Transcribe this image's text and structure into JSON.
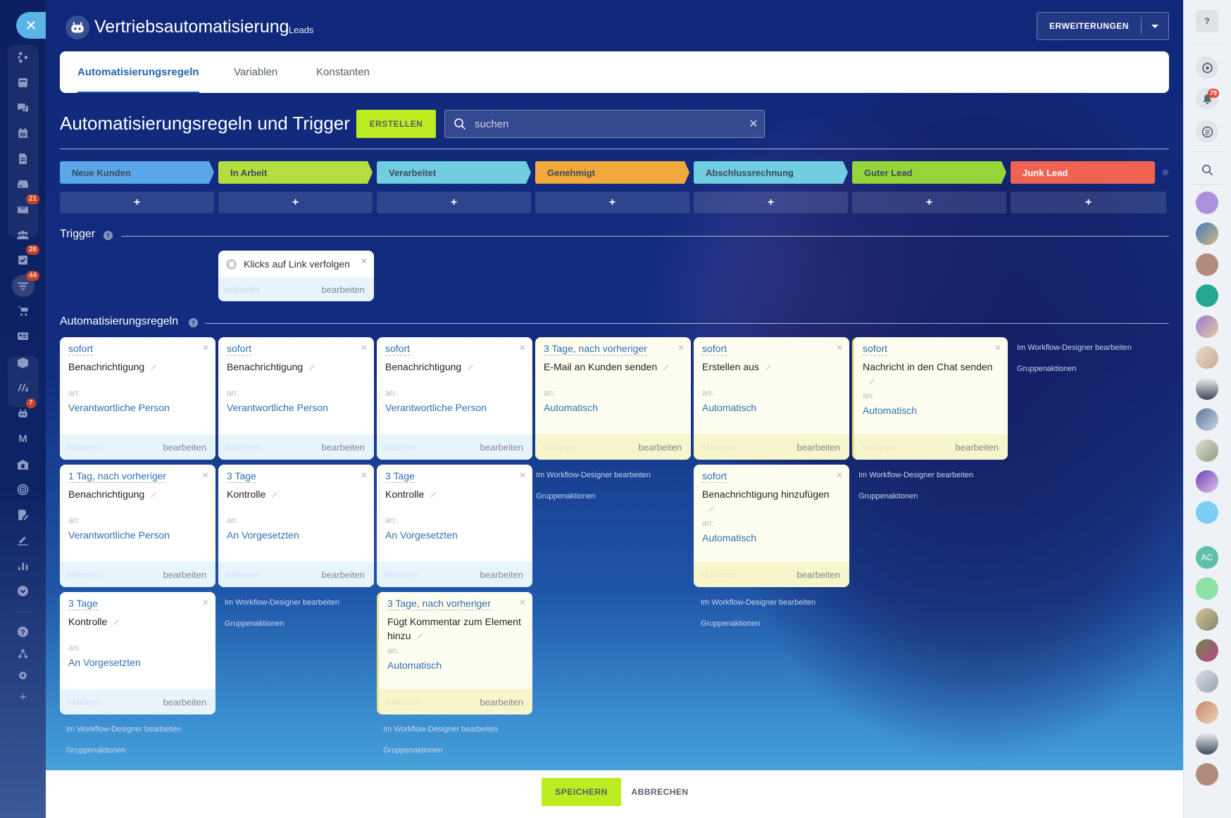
{
  "app": {
    "title": "Vertriebsautomatisierung",
    "subtitle": "Leads",
    "extensions_label": "ERWEITERUNGEN"
  },
  "tabs": [
    {
      "label": "Automatisierungsregeln",
      "active": true
    },
    {
      "label": "Variablen",
      "active": false
    },
    {
      "label": "Konstanten",
      "active": false
    }
  ],
  "toolbar": {
    "page_title": "Automatisierungsregeln und Trigger",
    "create_label": "ERSTELLEN",
    "search_placeholder": "suchen",
    "search_value": ""
  },
  "stages": [
    {
      "label": "Neue Kunden",
      "color": "#5aa6e8"
    },
    {
      "label": "In Arbeit",
      "color": "#b6dd3f"
    },
    {
      "label": "Verarbeitet",
      "color": "#71cde0"
    },
    {
      "label": "Genehmigt",
      "color": "#f2a93b"
    },
    {
      "label": "Abschlussrechnung",
      "color": "#71cde0"
    },
    {
      "label": "Guter Lead",
      "color": "#96d43c"
    },
    {
      "label": "Junk Lead",
      "color": "#ee6352"
    }
  ],
  "add_label": "+",
  "sections": {
    "trigger": "Trigger",
    "rules": "Automatisierungsregeln"
  },
  "trigger_card": {
    "name": "Klicks auf Link verfolgen",
    "copy": "kopieren",
    "edit": "bearbeiten"
  },
  "card_labels": {
    "to": "an:",
    "actions": "Aktionen",
    "edit": "bearbeiten"
  },
  "links": {
    "workflow": "Im Workflow-Designer bearbeiten",
    "group": "Gruppenaktionen"
  },
  "rules": [
    {
      "delay": "sofort",
      "name": "Benachrichtigung",
      "to": "Verantwortliche Person"
    },
    {
      "delay": "sofort",
      "name": "Benachrichtigung",
      "to": "Verantwortliche Person"
    },
    {
      "delay": "sofort",
      "name": "Benachrichtigung",
      "to": "Verantwortliche Person"
    },
    {
      "delay": "3 Tage, nach vorheriger",
      "name": "E-Mail an Kunden senden",
      "to": "Automatisch"
    },
    {
      "delay": "sofort",
      "name": "Erstellen aus",
      "to": "Automatisch"
    },
    {
      "delay": "sofort",
      "name": "Nachricht in den Chat senden",
      "to": "Automatisch"
    },
    {
      "delay": "1 Tag, nach vorheriger",
      "name": "Benachrichtigung",
      "to": "Verantwortliche Person"
    },
    {
      "delay": "3 Tage",
      "name": "Kontrolle",
      "to": "An Vorgesetzten"
    },
    {
      "delay": "3 Tage",
      "name": "Kontrolle",
      "to": "An Vorgesetzten"
    },
    {
      "delay": "sofort",
      "name": "Benachrichtigung hinzufügen",
      "to": "Automatisch"
    },
    {
      "delay": "3 Tage",
      "name": "Kontrolle",
      "to": "An Vorgesetzten"
    },
    {
      "delay": "3 Tage, nach vorheriger",
      "name": "Fügt Kommentar zum Element hinzu",
      "to": "Automatisch"
    }
  ],
  "footer": {
    "save": "SPEICHERN",
    "cancel": "ABBRECHEN"
  },
  "left_nav": {
    "badges": {
      "mail": "21",
      "tasks": "26",
      "crm": "44",
      "robots": "7"
    },
    "m_label": "M"
  },
  "right_bar": {
    "notifications_badge": "79",
    "avatar_initials": "AC",
    "help": "?"
  }
}
